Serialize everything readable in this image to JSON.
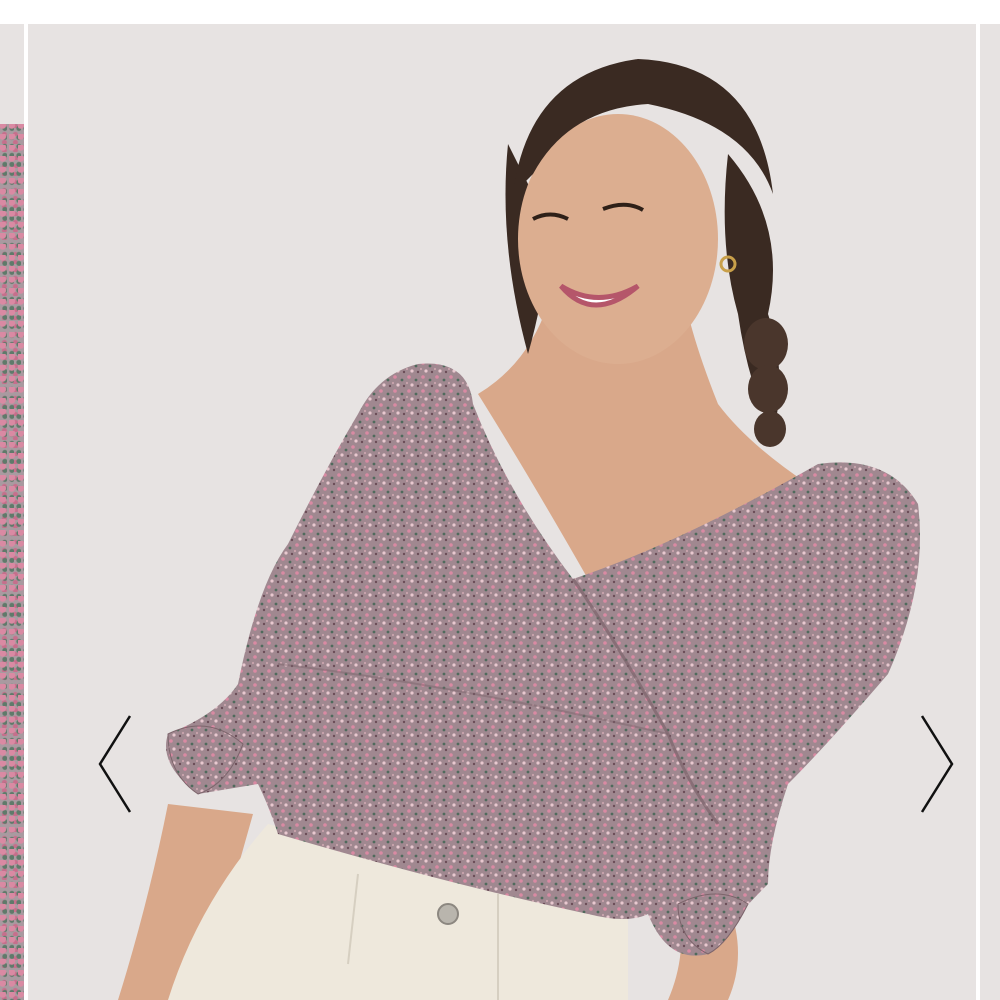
{
  "carousel": {
    "main_image": {
      "alt": "",
      "colors": {
        "background": "#e7e3e2",
        "blouse": "#9b8287",
        "jeans": "#eee8dc",
        "skin": "#d9a88a",
        "hair": "#3a2a22"
      }
    },
    "prev_arrow": {
      "icon": "chevron-left-icon"
    },
    "next_arrow": {
      "icon": "chevron-right-icon"
    }
  }
}
